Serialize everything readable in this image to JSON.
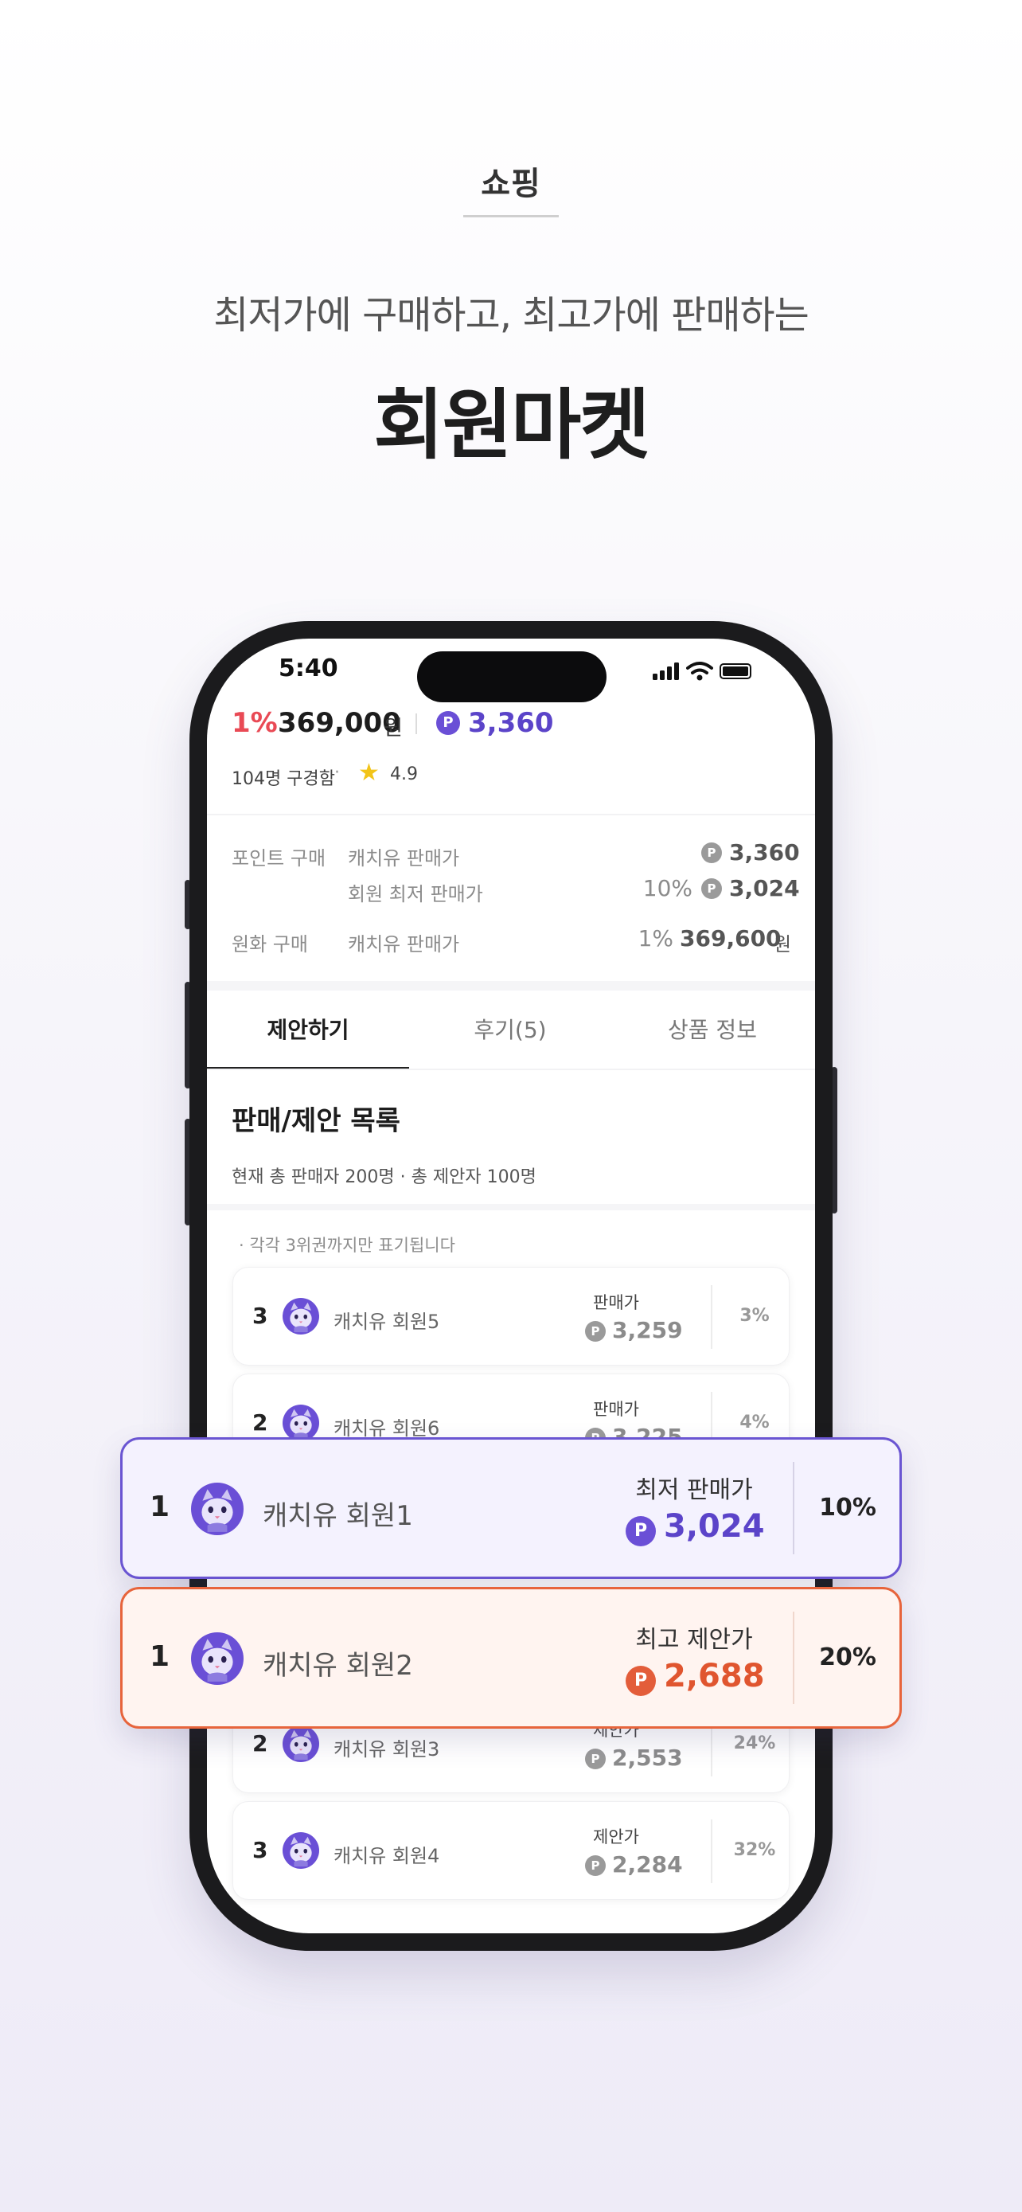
{
  "header": {
    "category": "쇼핑",
    "subtitle": "최저가에 구매하고, 최고가에 판매하는",
    "headline": "회원마켓"
  },
  "status_bar": {
    "time": "5:40"
  },
  "product": {
    "discount": "1%",
    "price": "369,000",
    "price_unit": "원",
    "point_price": "3,360",
    "buyers": "104명 구경함",
    "dot": "·",
    "rating": "4.9"
  },
  "purchase_info": {
    "point_label": "포인트 구매",
    "point_rows": [
      {
        "label": "캐치유 판매가",
        "percent": "",
        "value": "3,360"
      },
      {
        "label": "회원 최저 판매가",
        "percent": "10%",
        "value": "3,024"
      }
    ],
    "cash_label": "원화 구매",
    "cash_row": {
      "label": "캐치유 판매가",
      "percent": "1%",
      "value": "369,600",
      "unit": "원"
    }
  },
  "tabs": [
    {
      "label": "제안하기",
      "active": true
    },
    {
      "label": "후기(5)",
      "active": false
    },
    {
      "label": "상품 정보",
      "active": false
    }
  ],
  "list_section": {
    "title": "판매/제안 목록",
    "meta": "현재 총 판매자 200명  ·  총 제안자 100명",
    "notice": "·   각각 3위권까지만 표기됩니다"
  },
  "rows": [
    {
      "rank": "3",
      "name": "캐치유 회원5",
      "price_label": "판매가",
      "value": "3,259",
      "percent": "3%"
    },
    {
      "rank": "2",
      "name": "캐치유 회원6",
      "price_label": "판매가",
      "value": "3,225",
      "percent": "4%"
    },
    {
      "rank": "2",
      "name": "캐치유 회원3",
      "price_label": "제안가",
      "value": "2,553",
      "percent": "24%"
    },
    {
      "rank": "3",
      "name": "캐치유 회원4",
      "price_label": "제안가",
      "value": "2,284",
      "percent": "32%"
    }
  ],
  "highlight_cards": [
    {
      "rank": "1",
      "name": "캐치유 회원1",
      "price_label": "최저 판매가",
      "value": "3,024",
      "percent": "10%"
    },
    {
      "rank": "1",
      "name": "캐치유 회원2",
      "price_label": "최고 제안가",
      "value": "2,688",
      "percent": "20%"
    }
  ],
  "icons": {
    "point": "P",
    "star": "★",
    "signal": "signal-icon",
    "wifi": "wifi-icon",
    "battery": "battery-icon",
    "avatar": "cat-avatar-icon"
  },
  "colors": {
    "brand_purple": "#6a4fd6",
    "discount_red": "#e94a55",
    "offer_orange": "#e7643c"
  }
}
